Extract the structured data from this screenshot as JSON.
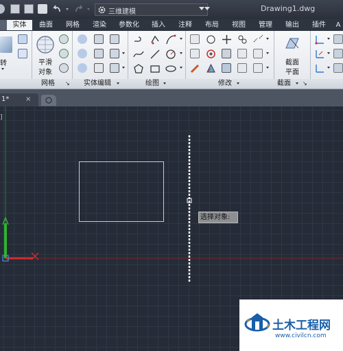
{
  "title_bar": {
    "workspace": "三维建模",
    "document_title": "Drawing1.dwg"
  },
  "ribbon_tabs": [
    "实体",
    "曲面",
    "网格",
    "渲染",
    "参数化",
    "插入",
    "注释",
    "布局",
    "视图",
    "管理",
    "输出",
    "插件",
    "A"
  ],
  "active_tab_index": 0,
  "ribbon_panels": {
    "mesh_label": "网格",
    "solid_edit_label": "实体编辑",
    "draw_label": "绘图",
    "modify_label": "修改",
    "section_label": "截面"
  },
  "big_buttons": {
    "revolve_label": "转",
    "smooth_line1": "平滑",
    "smooth_line2": "对象",
    "section_plane_line1": "截面",
    "section_plane_line2": "平面"
  },
  "file_tab": {
    "name": "1*",
    "close": "×"
  },
  "viewport": {
    "label": "]",
    "tooltip": "选择对象:"
  },
  "watermark": {
    "title": "土木工程网",
    "url": "www.civilcn.com"
  },
  "colors": {
    "canvas": "#252c38",
    "axis_x": "#d42a2a",
    "axis_y": "#2ab52a",
    "accent": "#1a5fa8"
  }
}
